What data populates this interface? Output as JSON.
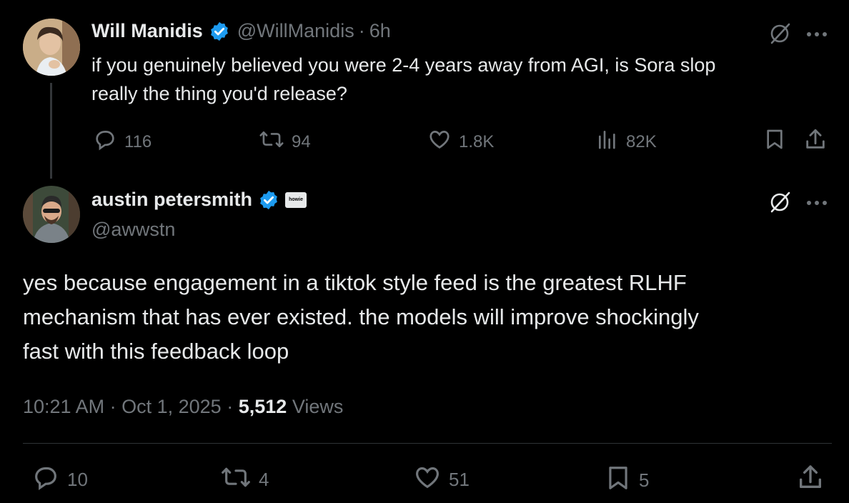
{
  "tweet1": {
    "name": "Will Manidis",
    "handle": "@WillManidis",
    "time_sep": "·",
    "time": "6h",
    "text_line1": "if you genuinely believed you were 2-4 years away from AGI, is Sora slop",
    "text_line2": "really the thing you'd release?",
    "replies": "116",
    "reposts": "94",
    "likes": "1.8K",
    "views": "82K"
  },
  "tweet2": {
    "name": "austin petersmith",
    "handle": "@awwstn",
    "affiliate_badge": "howie",
    "text_line1": "yes because engagement in a tiktok style feed is the greatest RLHF",
    "text_line2": "mechanism that has ever existed. the models will improve shockingly",
    "text_line3": "fast with this feedback loop",
    "time": "10:21 AM",
    "sep1": "·",
    "date": "Oct 1, 2025",
    "sep2": "·",
    "views_count": "5,512",
    "views_label": "Views",
    "replies": "10",
    "reposts": "4",
    "likes": "51",
    "bookmarks": "5"
  },
  "colors": {
    "background": "#000000",
    "text": "#e7e9ea",
    "muted": "#71767b",
    "verified": "#1d9bf0",
    "divider": "#2f3336"
  },
  "icons": [
    "verified-badge-icon",
    "grok-icon",
    "more-icon",
    "reply-icon",
    "repost-icon",
    "like-icon",
    "views-icon",
    "bookmark-icon",
    "share-icon"
  ]
}
